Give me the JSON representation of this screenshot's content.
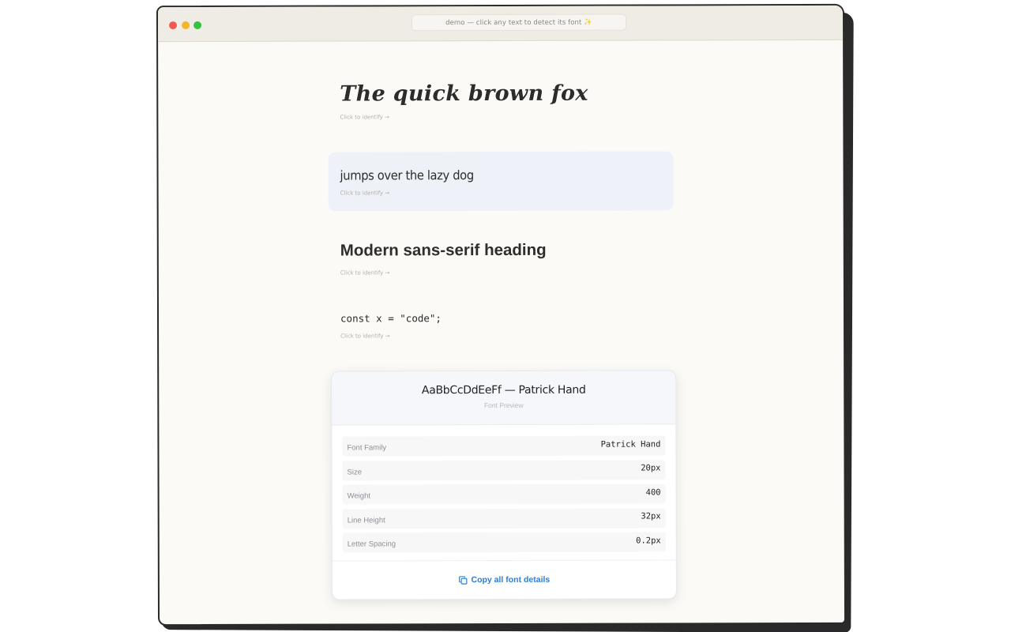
{
  "window": {
    "url_text": "demo — click any text to detect its font ✨"
  },
  "samples": [
    {
      "text": "The quick brown fox",
      "hint": "Click to identify →"
    },
    {
      "text": "jumps over the lazy dog",
      "hint": "Click to identify →"
    },
    {
      "text": "Modern sans-serif heading",
      "hint": "Click to identify →"
    },
    {
      "text": "const x = \"code\";",
      "hint": "Click to identify →"
    }
  ],
  "card": {
    "preview_text": "AaBbCcDdEeFf — Patrick Hand",
    "preview_label": "Font Preview",
    "rows": [
      {
        "label": "Font Family",
        "value": "Patrick Hand"
      },
      {
        "label": "Size",
        "value": "20px"
      },
      {
        "label": "Weight",
        "value": "400"
      },
      {
        "label": "Line Height",
        "value": "32px"
      },
      {
        "label": "Letter Spacing",
        "value": "0.2px"
      }
    ],
    "copy_label": "Copy all font details"
  },
  "colors": {
    "accent": "#2d7fd3",
    "active_sample_bg": "#eef2f8",
    "close": "#ef5b53",
    "minimize": "#f1b52e",
    "maximize": "#36c240"
  },
  "icons": {
    "copy": "copy-icon"
  }
}
